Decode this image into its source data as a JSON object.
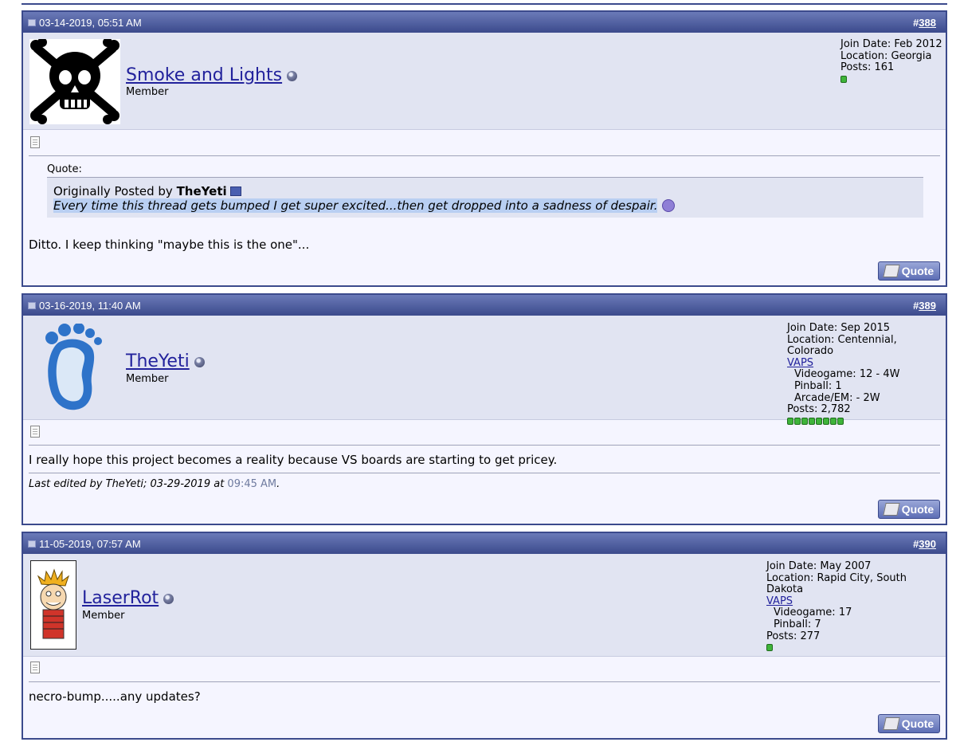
{
  "posts": [
    {
      "date": "03-14-2019, 05:51 AM",
      "number_prefix": "#",
      "number": "388",
      "username": "Smoke and Lights",
      "usertitle": "Member",
      "join_date": "Join Date: Feb 2012",
      "location": "Location: Georgia",
      "posts": "Posts: 161",
      "rep_pips": 1,
      "quote_label": "Quote:",
      "quote_prefix": "Originally Posted by ",
      "quote_author": "TheYeti",
      "quote_text": "Every time this thread gets bumped I get super excited...then get dropped into a sadness of despair.",
      "message": "Ditto. I keep thinking \"maybe this is the one\"...",
      "quote_button": "Quote"
    },
    {
      "date": "03-16-2019, 11:40 AM",
      "number_prefix": "#",
      "number": "389",
      "username": "TheYeti",
      "usertitle": "Member",
      "join_date": "Join Date: Sep 2015",
      "location": "Location: Centennial, Colorado",
      "vaps_link": "VAPS",
      "vaps_lines": [
        "Videogame: 12 - 4W",
        "Pinball: 1",
        "Arcade/EM: - 2W"
      ],
      "posts": "Posts: 2,782",
      "rep_pips": 8,
      "message": "I really hope this project becomes a reality because VS boards are starting to get pricey.",
      "edited_prefix": "Last edited by TheYeti; 03-29-2019 at ",
      "edited_time": "09:45 AM",
      "edited_suffix": ".",
      "quote_button": "Quote"
    },
    {
      "date": "11-05-2019, 07:57 AM",
      "number_prefix": "#",
      "number": "390",
      "username": "LaserRot",
      "usertitle": "Member",
      "join_date": "Join Date: May 2007",
      "location": "Location: Rapid City, South Dakota",
      "vaps_link": "VAPS",
      "vaps_lines": [
        "Videogame: 17",
        "Pinball: 7"
      ],
      "posts": "Posts: 277",
      "rep_pips": 1,
      "message": "necro-bump.....any updates?",
      "quote_button": "Quote"
    }
  ]
}
